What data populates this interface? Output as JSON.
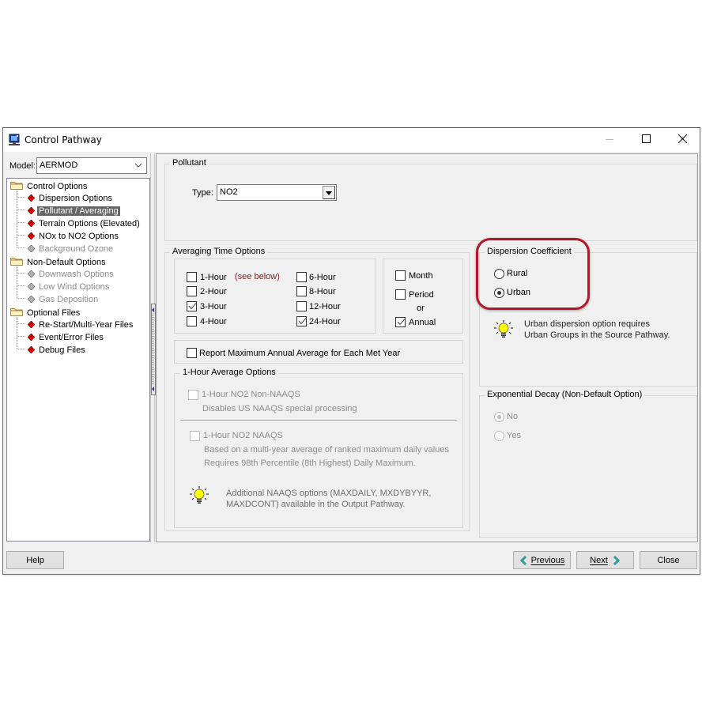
{
  "window": {
    "title": "Control Pathway",
    "icon": "monitor-app-icon",
    "controls": [
      "minimize-icon",
      "maximize-icon",
      "close-icon"
    ]
  },
  "model": {
    "label": "Model:",
    "value": "AERMOD"
  },
  "tree": {
    "groups": [
      {
        "label": "Control Options",
        "items": [
          {
            "label": "Dispersion Options",
            "state": "enabled"
          },
          {
            "label": "Pollutant / Averaging",
            "state": "selected"
          },
          {
            "label": "Terrain Options (Elevated)",
            "state": "enabled"
          },
          {
            "label": "NOx to NO2 Options",
            "state": "enabled"
          },
          {
            "label": "Background Ozone",
            "state": "disabled"
          }
        ]
      },
      {
        "label": "Non-Default Options",
        "items": [
          {
            "label": "Downwash Options",
            "state": "disabled"
          },
          {
            "label": "Low Wind Options",
            "state": "disabled"
          },
          {
            "label": "Gas Deposition",
            "state": "disabled"
          }
        ]
      },
      {
        "label": "Optional Files",
        "items": [
          {
            "label": "Re-Start/Multi-Year Files",
            "state": "enabled"
          },
          {
            "label": "Event/Error Files",
            "state": "enabled"
          },
          {
            "label": "Debug Files",
            "state": "enabled"
          }
        ]
      }
    ]
  },
  "pollutant": {
    "title": "Pollutant",
    "type_label": "Type:",
    "type_value": "NO2"
  },
  "averaging": {
    "title": "Averaging Time Options",
    "see_below": "(see below)",
    "short_term": [
      {
        "label": "1-Hour",
        "checked": false
      },
      {
        "label": "2-Hour",
        "checked": false
      },
      {
        "label": "3-Hour",
        "checked": true
      },
      {
        "label": "4-Hour",
        "checked": false
      },
      {
        "label": "6-Hour",
        "checked": false
      },
      {
        "label": "8-Hour",
        "checked": false
      },
      {
        "label": "12-Hour",
        "checked": false
      },
      {
        "label": "24-Hour",
        "checked": true
      }
    ],
    "long_term": {
      "month": {
        "label": "Month",
        "checked": false
      },
      "period": {
        "label": "Period",
        "checked": false
      },
      "or_label": "or",
      "annual": {
        "label": "Annual",
        "checked": true
      }
    },
    "report_max_annual": {
      "label": "Report Maximum Annual Average for Each Met Year",
      "checked": false
    }
  },
  "one_hour": {
    "title": "1-Hour Average Options",
    "non_naaqs": {
      "label": "1-Hour NO2 Non-NAAQS",
      "checked": false,
      "desc": "Disables US NAAQS special processing"
    },
    "naaqs": {
      "label": "1-Hour NO2 NAAQS",
      "checked": false,
      "desc1": "Based on a multi-year average of ranked maximum daily values",
      "desc2": "Requires 98th Percentile (8th Highest) Daily Maximum."
    },
    "tip_line1": "Additional NAAQS options (MAXDAILY, MXDYBYYR,",
    "tip_line2": "MAXDCONT) available in the Output Pathway."
  },
  "dispersion": {
    "title": "Dispersion Coefficient",
    "options": [
      {
        "label": "Rural",
        "selected": false
      },
      {
        "label": "Urban",
        "selected": true
      }
    ],
    "tip_line1": "Urban dispersion option requires",
    "tip_line2": "Urban Groups in the Source Pathway.",
    "highlight_color": "#b3172a"
  },
  "decay": {
    "title": "Exponential Decay (Non-Default Option)",
    "options": [
      {
        "label": "No",
        "selected": true
      },
      {
        "label": "Yes",
        "selected": false
      }
    ]
  },
  "buttons": {
    "help": "Help",
    "previous": "Previous",
    "next": "Next",
    "close": "Close"
  }
}
